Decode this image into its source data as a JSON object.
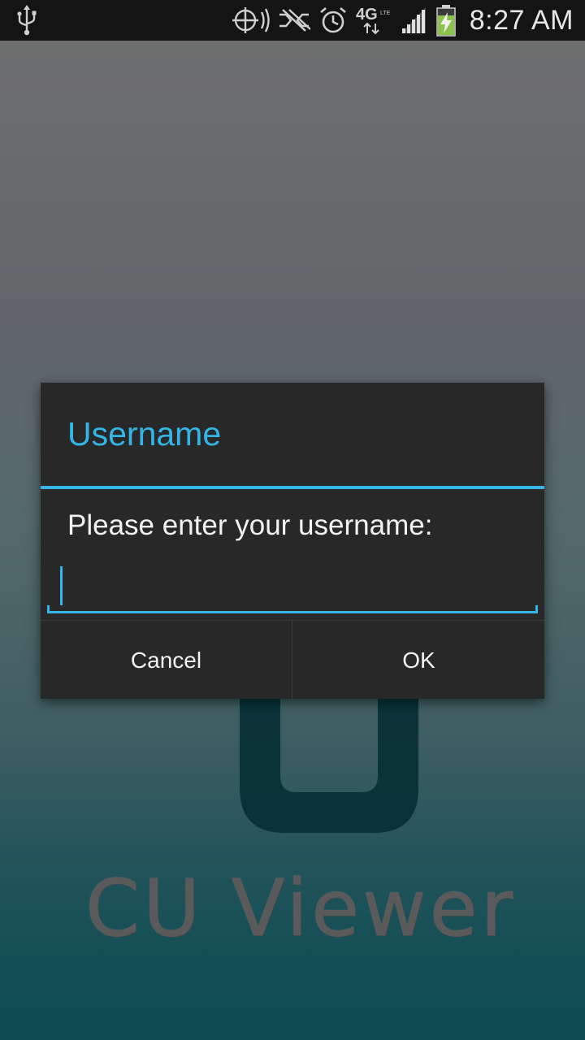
{
  "status_bar": {
    "time": "8:27 AM",
    "network_type": "4G",
    "network_sub": "LTE",
    "icons": [
      "usb-icon",
      "gps-icon",
      "wifi-off-icon",
      "alarm-icon",
      "network-4g-lte-icon",
      "signal-icon",
      "battery-charging-icon"
    ]
  },
  "dialog": {
    "title": "Username",
    "message": "Please enter your username:",
    "input_value": "",
    "cancel_label": "Cancel",
    "ok_label": "OK"
  },
  "app": {
    "name": "CU Viewer"
  },
  "colors": {
    "accent": "#33b5e5",
    "dialog_bg": "#282828",
    "status_bar_bg": "#141414"
  }
}
